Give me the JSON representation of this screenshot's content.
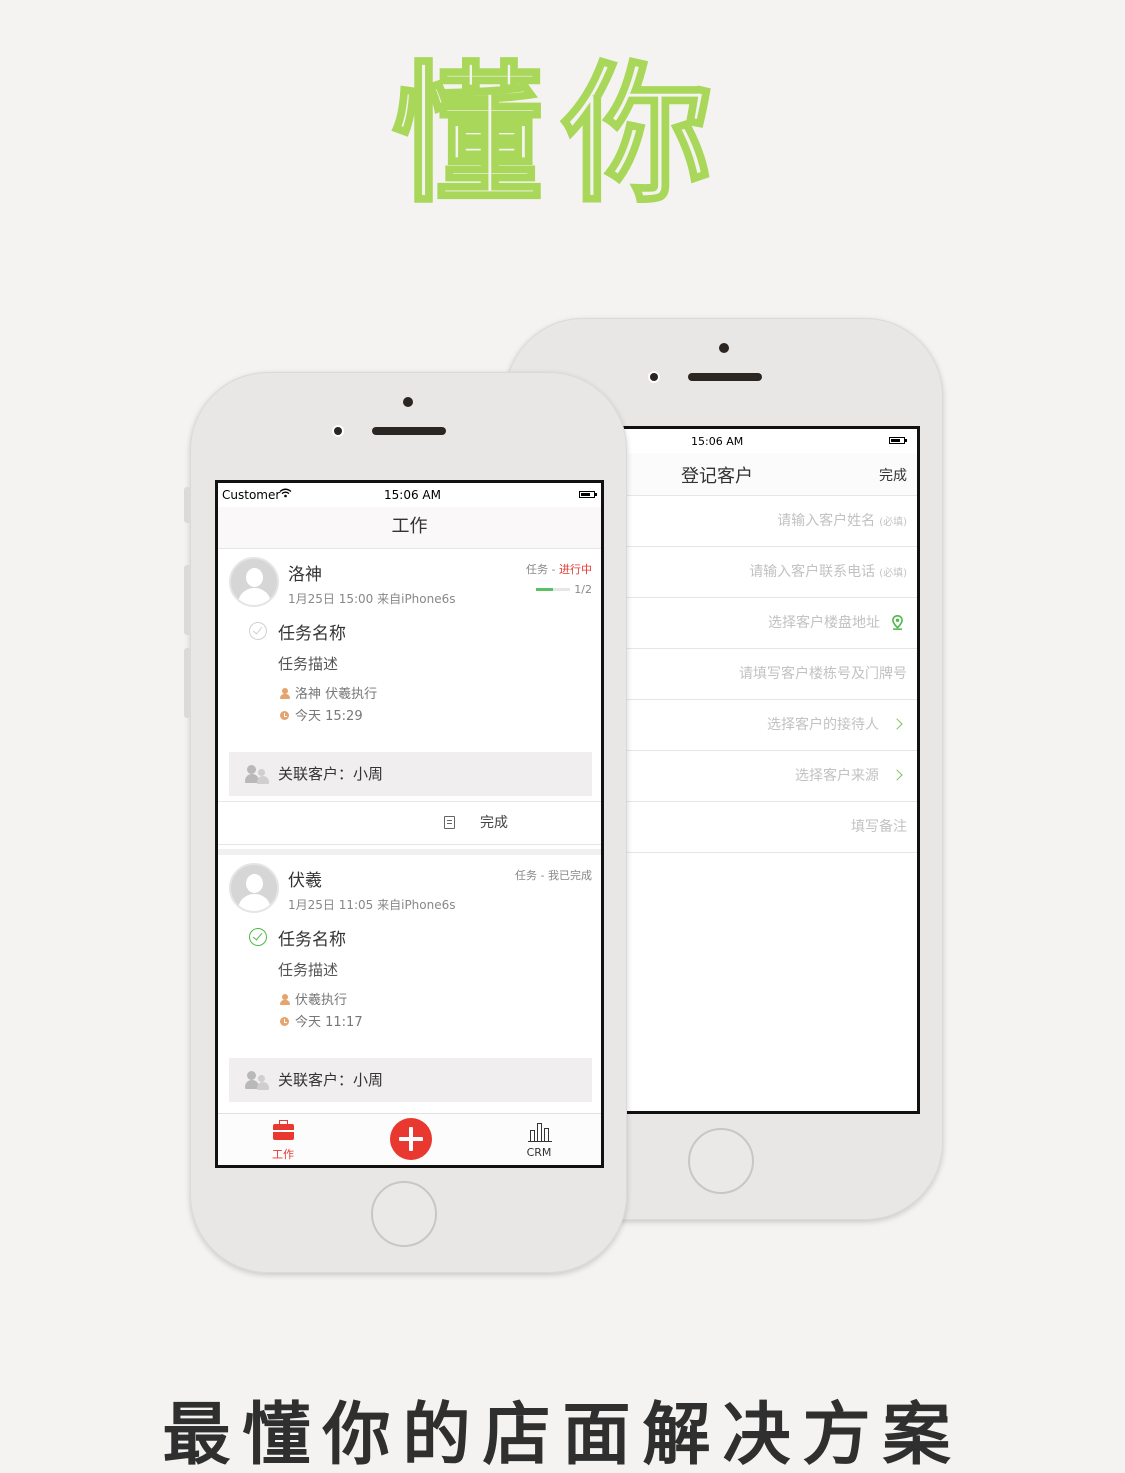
{
  "hero_title": "懂你",
  "slogan": "最懂你的店面解决方案",
  "register_screen": {
    "status_time": "15:06 AM",
    "title": "登记客户",
    "done_label": "完成",
    "fields": [
      {
        "placeholder": "请输入客户姓名",
        "hint": "(必填)",
        "icon": ""
      },
      {
        "placeholder": "请输入客户联系电话",
        "hint": "(必填)",
        "icon": ""
      },
      {
        "placeholder": "选择客户楼盘地址",
        "hint": "",
        "icon": "location-pin-icon"
      },
      {
        "placeholder": "请填写客户楼栋号及门牌号",
        "hint": "",
        "icon": ""
      },
      {
        "placeholder": "选择客户的接待人",
        "hint": "",
        "icon": "chevron-right-icon"
      },
      {
        "placeholder": "选择客户来源",
        "hint": "",
        "icon": "chevron-right-icon"
      },
      {
        "placeholder": "填写备注",
        "hint": "",
        "icon": ""
      }
    ]
  },
  "work_screen": {
    "carrier": "Customer",
    "status_time": "15:06 AM",
    "title": "工作",
    "cards": [
      {
        "name": "洛神",
        "meta": "1月25日  15:00   来自iPhone6s",
        "tag_prefix": "任务 - ",
        "tag_status": "进行中",
        "progress_text": "1/2",
        "progress_value": 0.5,
        "task_done": false,
        "task_name": "任务名称",
        "task_desc": "任务描述",
        "executor": "洛神 伏羲执行",
        "time": "今天   15:29",
        "related_customer": "关联客户：小周",
        "complete_label": "完成"
      },
      {
        "name": "伏羲",
        "meta": "1月25日  11:05   来自iPhone6s",
        "tag_prefix": "任务 - 我已完成",
        "tag_status": "",
        "task_done": true,
        "task_name": "任务名称",
        "task_desc": "任务描述",
        "executor": "伏羲执行",
        "time": "今天   11:17",
        "related_customer": "关联客户：小周"
      }
    ],
    "tabbar": {
      "work_label": "工作",
      "crm_label": "CRM"
    }
  },
  "colors": {
    "accent_red": "#e8382f",
    "accent_green": "#5cc064",
    "hero_stroke": "#a8d75a"
  }
}
